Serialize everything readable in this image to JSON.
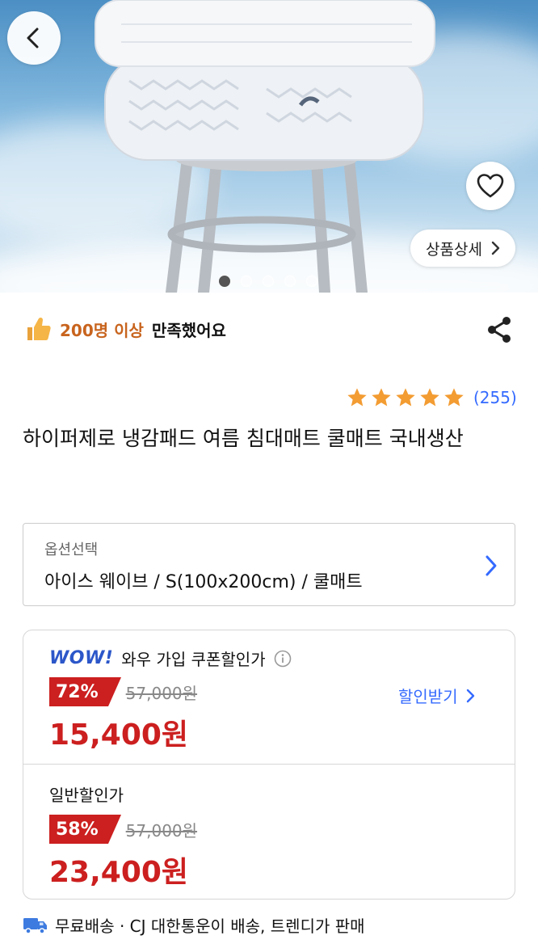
{
  "hero": {
    "detail_button_label": "상품상세",
    "image_count": 5,
    "active_index": 0
  },
  "icons": {
    "back": "back-arrow-icon",
    "heart": "heart-icon",
    "share": "share-icon",
    "thumbs_up": "thumbs-up-icon",
    "truck": "delivery-truck-icon",
    "info": "info-icon"
  },
  "satisfaction": {
    "highlight": "200명 이상",
    "suffix": "만족했어요"
  },
  "rating": {
    "stars": 5,
    "count_text": "(255)"
  },
  "product": {
    "title": "하이퍼제로 냉감패드 여름 침대매트 쿨매트 국내생산"
  },
  "option": {
    "label": "옵션선택",
    "value": "아이스 웨이브 / S(100x200cm) / 쿨매트"
  },
  "price": {
    "wow": {
      "logo": "WOW!",
      "label": "와우 가입 쿠폰할인가",
      "discount": "72%",
      "original": "57,000원",
      "final": "15,400원",
      "coupon_link": "할인받기"
    },
    "normal": {
      "label": "일반할인가",
      "discount": "58%",
      "original": "57,000원",
      "final": "23,400원"
    }
  },
  "delivery": {
    "text": "무료배송 · CJ 대한통운이 배송, 트렌디가 판매"
  },
  "colors": {
    "accent_blue": "#346aff",
    "price_red": "#cc1f1f",
    "star_orange": "#f39c32",
    "satisfy_orange": "#c8641e"
  }
}
